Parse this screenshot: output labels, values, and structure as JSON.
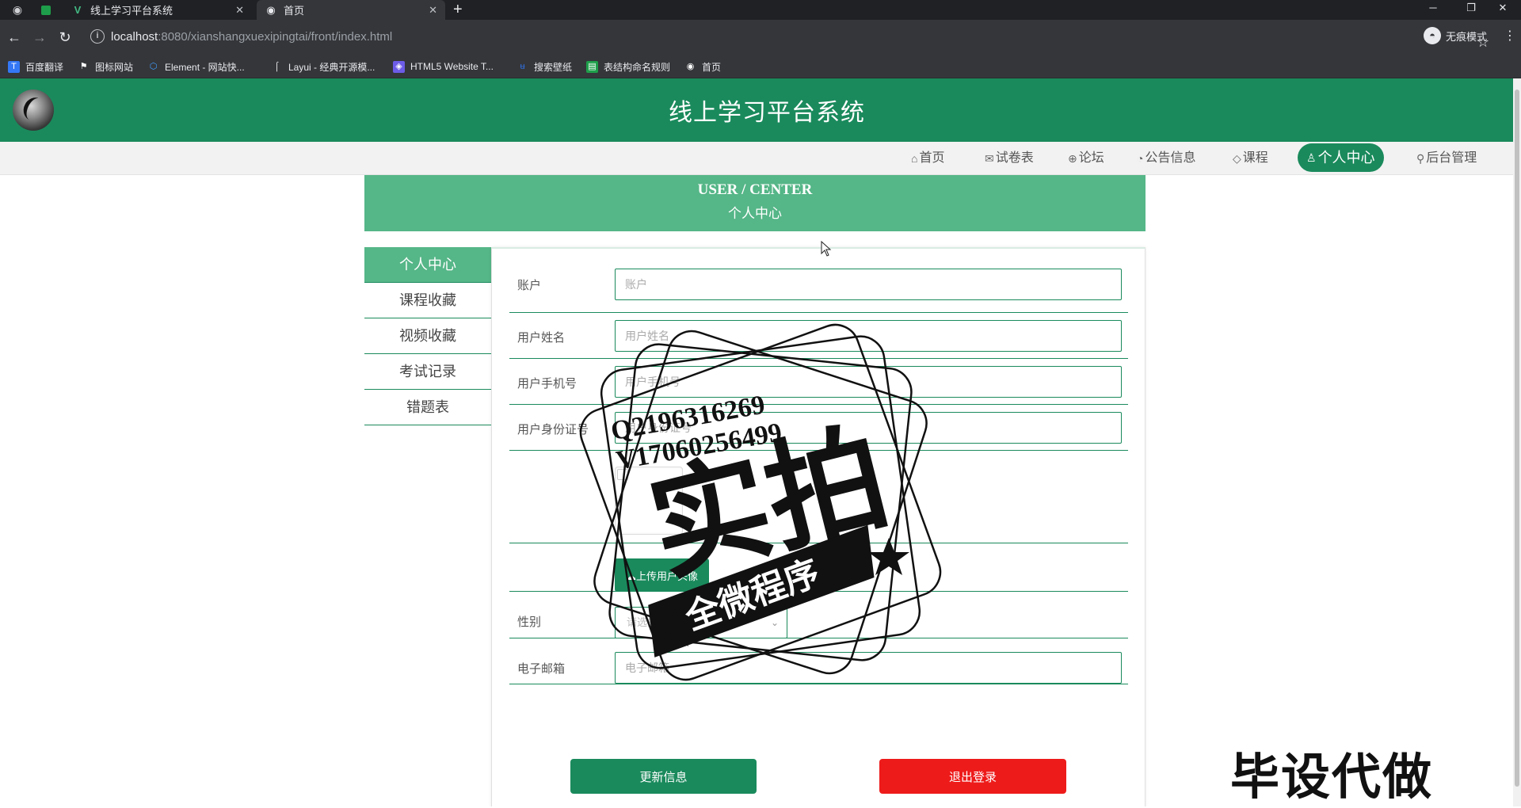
{
  "browser": {
    "tabs": [
      {
        "title": "线上学习平台系统",
        "icon": "vue-icon"
      },
      {
        "title": "首页",
        "icon": "globe-icon"
      }
    ],
    "url_host": "localhost",
    "url_rest": ":8080/xianshangxuexipingtai/front/index.html",
    "incognito_label": "无痕模式",
    "bookmarks": [
      {
        "label": "百度翻译",
        "icon": "translate-icon",
        "color": "#3478f6"
      },
      {
        "label": "图标网站",
        "icon": "flag-icon",
        "color": "#35363a"
      },
      {
        "label": "Element - 网站快...",
        "icon": "element-icon",
        "color": "#409eff"
      },
      {
        "label": "Layui - 经典开源模...",
        "icon": "layui-icon",
        "color": "#35363a"
      },
      {
        "label": "HTML5 Website T...",
        "icon": "html5-icon",
        "color": "#6c5ce7"
      },
      {
        "label": "搜索壁纸",
        "icon": "wallpaper-icon",
        "color": "#2f6fe0"
      },
      {
        "label": "表结构命名规则",
        "icon": "sheet-icon",
        "color": "#1e9e4a"
      },
      {
        "label": "首页",
        "icon": "globe-icon",
        "color": "#35363a"
      }
    ]
  },
  "header": {
    "title": "线上学习平台系统"
  },
  "nav": [
    {
      "label": "首页",
      "icon": "⌂"
    },
    {
      "label": "试卷表",
      "icon": "✉"
    },
    {
      "label": "论坛",
      "icon": "⊕"
    },
    {
      "label": "公告信息",
      "icon": "◔"
    },
    {
      "label": "课程",
      "icon": "◇"
    },
    {
      "label": "个人中心",
      "icon": "♙"
    },
    {
      "label": "后台管理",
      "icon": "⚲"
    }
  ],
  "banner": {
    "en": "USER / CENTER",
    "cn": "个人中心"
  },
  "sidebar": {
    "items": [
      {
        "label": "个人中心"
      },
      {
        "label": "课程收藏"
      },
      {
        "label": "视频收藏"
      },
      {
        "label": "考试记录"
      },
      {
        "label": "错题表"
      }
    ]
  },
  "form": {
    "account": {
      "label": "账户",
      "placeholder": "账户"
    },
    "name": {
      "label": "用户姓名",
      "placeholder": "用户姓名"
    },
    "phone": {
      "label": "用户手机号",
      "placeholder": "用户手机号"
    },
    "idcard": {
      "label": "用户身份证号",
      "placeholder": "用户身份证号"
    },
    "upload_label": "上传用户头像",
    "gender": {
      "label": "性别",
      "placeholder": "请选择性别"
    },
    "email": {
      "label": "电子邮箱",
      "placeholder": "电子邮箱"
    },
    "update_label": "更新信息",
    "logout_label": "退出登录"
  },
  "watermark": {
    "line1": "Q2196316269",
    "line2": "V17060256499",
    "big": "实拍",
    "ribbon": "全微程序",
    "corner": "毕设代做"
  },
  "colors": {
    "brand_green": "#1a8a5c",
    "light_green": "#55b687",
    "logout_red": "#ee1b1b"
  }
}
